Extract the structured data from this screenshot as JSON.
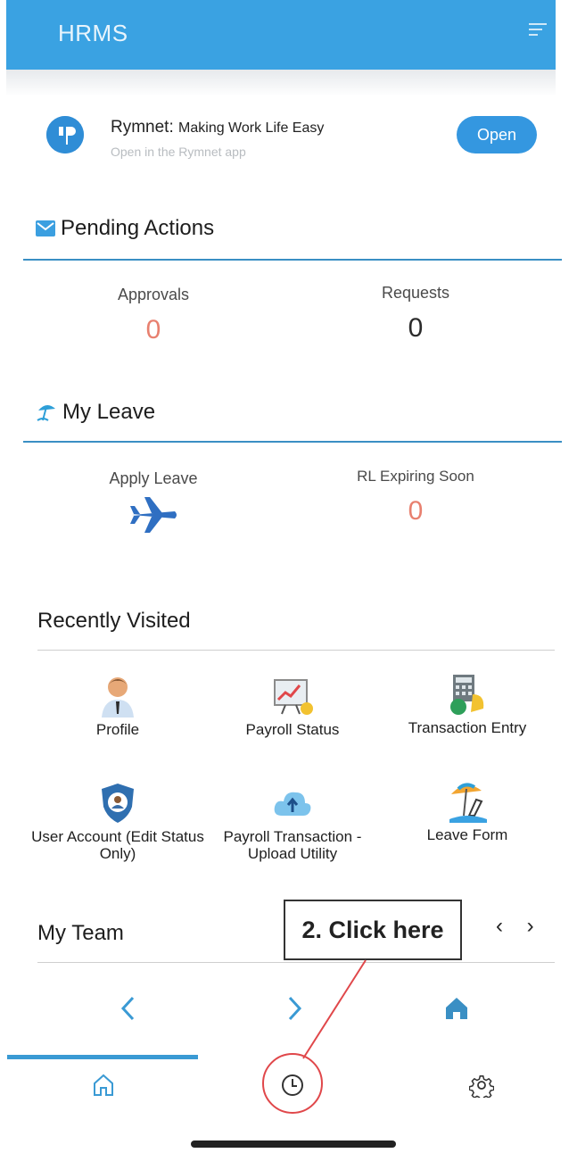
{
  "header": {
    "title": "HRMS"
  },
  "banner": {
    "app_name": "Rymnet:",
    "tagline": "Making Work Life Easy",
    "subtitle": "Open in the Rymnet app",
    "open_label": "Open"
  },
  "pending": {
    "title": "Pending Actions",
    "approvals_label": "Approvals",
    "approvals_value": "0",
    "requests_label": "Requests",
    "requests_value": "0"
  },
  "leave": {
    "title": "My Leave",
    "apply_label": "Apply Leave",
    "expiring_label": "RL Expiring Soon",
    "expiring_value": "0"
  },
  "recent": {
    "title": "Recently Visited",
    "items": [
      {
        "label": "Profile",
        "icon": "person-icon"
      },
      {
        "label": "Payroll Status",
        "icon": "chart-board-icon"
      },
      {
        "label": "Transaction Entry",
        "icon": "calculator-icon"
      },
      {
        "label": "User Account (Edit Status Only)",
        "icon": "shield-user-icon"
      },
      {
        "label": "Payroll Transaction - Upload Utility",
        "icon": "cloud-upload-icon"
      },
      {
        "label": "Leave Form",
        "icon": "beach-icon"
      }
    ]
  },
  "team": {
    "title": "My Team"
  },
  "callout": {
    "text": "2. Click here"
  },
  "colors": {
    "header": "#3aa2e2",
    "accent": "#3a8fc4",
    "zero_red": "#e8806f",
    "callout_red": "#e0474a"
  }
}
